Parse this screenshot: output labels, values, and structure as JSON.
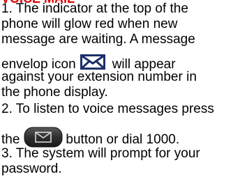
{
  "heading": "VOICE MAIL",
  "steps": {
    "s1_l1": "1. The indicator at the top of the",
    "s1_l2": "phone will glow red when new",
    "s1_l3": "message are waiting. A message",
    "s1_l4_a": "envelop icon",
    "s1_l4_b": "will appear",
    "s1_l5": "against your extension number in",
    "s1_l6": "the phone display.",
    "s2_l1": "2. To listen to voice messages press",
    "s2_l2_a": "the",
    "s2_l2_b": "button or dial 1000.",
    "s3_l1": "3. The system will prompt for your",
    "s3_l2": "password."
  },
  "icons": {
    "envelope": "envelope-icon",
    "message_button": "message-button-icon"
  },
  "colors": {
    "heading": "#e00000",
    "text": "#000000",
    "icon_stroke": "#1c2f6b",
    "button_fill": "#2f2f2f"
  }
}
